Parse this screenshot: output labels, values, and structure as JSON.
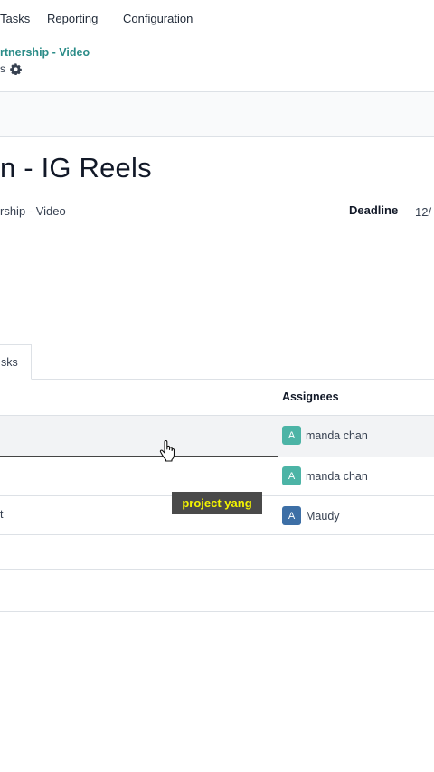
{
  "nav": {
    "tasks": "Tasks",
    "reporting": "Reporting",
    "configuration": "Configuration"
  },
  "breadcrumb": {
    "project": "rtnership - Video",
    "sub": "s",
    "gear_icon": "gear-icon"
  },
  "task": {
    "title": "n - IG Reels",
    "project_value": "rship - Video",
    "deadline_label": "Deadline",
    "deadline_value": "12/"
  },
  "tabs": {
    "subtasks": "sks"
  },
  "table": {
    "header_assignees": "Assignees",
    "rows": [
      {
        "left": "",
        "avatar": "A",
        "avatar_color": "#4cb4a6",
        "assignee": "manda chan"
      },
      {
        "left": "",
        "avatar": "A",
        "avatar_color": "#4cb4a6",
        "assignee": "manda chan"
      },
      {
        "left": "t",
        "avatar": "A",
        "avatar_color": "#3d6fa6",
        "assignee": "Maudy"
      }
    ]
  },
  "overlay": {
    "caption": "project yang"
  }
}
